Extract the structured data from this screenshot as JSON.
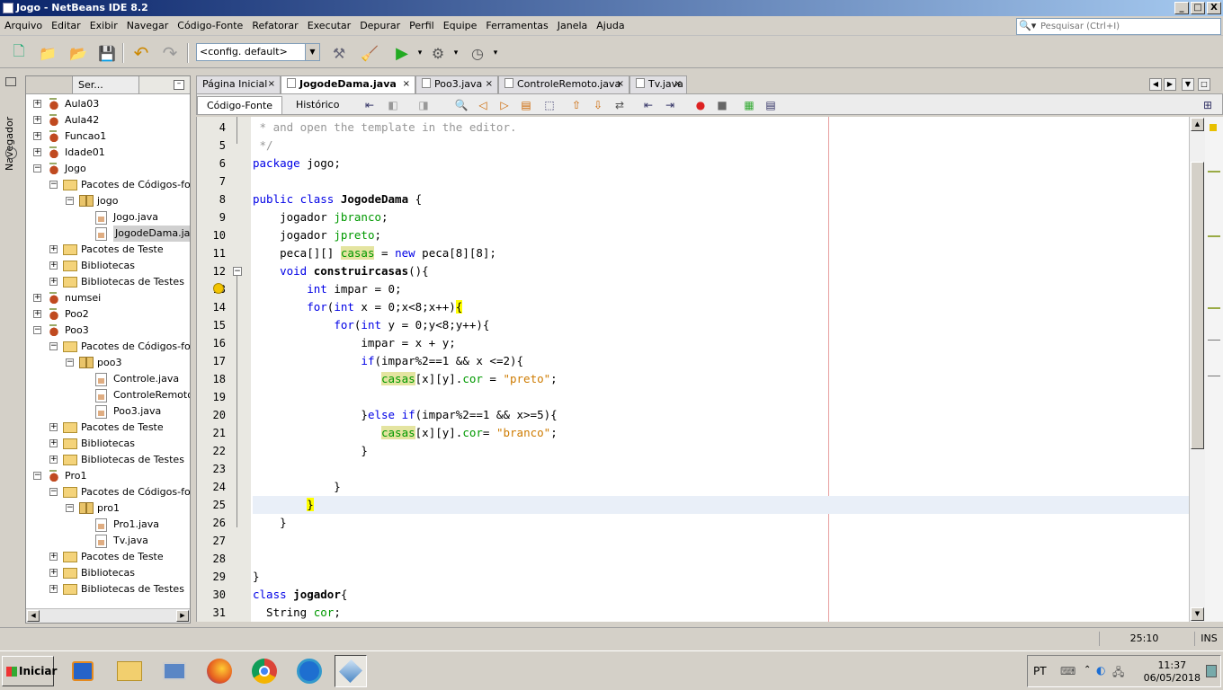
{
  "window": {
    "title": "Jogo - NetBeans IDE 8.2",
    "min": "_",
    "max": "□",
    "close": "X"
  },
  "menu": [
    "Arquivo",
    "Editar",
    "Exibir",
    "Navegar",
    "Código-Fonte",
    "Refatorar",
    "Executar",
    "Depurar",
    "Perfil",
    "Equipe",
    "Ferramentas",
    "Janela",
    "Ajuda"
  ],
  "search": {
    "placeholder": "Pesquisar (Ctrl+I)"
  },
  "toolbar": {
    "config": "<config. default>"
  },
  "navigator_label": "Navegador",
  "projects_panel": {
    "tab_label": "Ser...",
    "min": "–"
  },
  "tree": [
    {
      "label": "Aula03",
      "level": 0,
      "type": "project",
      "exp": "+"
    },
    {
      "label": "Aula42",
      "level": 0,
      "type": "project",
      "exp": "+"
    },
    {
      "label": "Funcao1",
      "level": 0,
      "type": "project",
      "exp": "+"
    },
    {
      "label": "Idade01",
      "level": 0,
      "type": "project",
      "exp": "+"
    },
    {
      "label": "Jogo",
      "level": 0,
      "type": "project",
      "exp": "−"
    },
    {
      "label": "Pacotes de Códigos-fonte",
      "level": 1,
      "type": "folder",
      "exp": "−"
    },
    {
      "label": "jogo",
      "level": 2,
      "type": "package",
      "exp": "−"
    },
    {
      "label": "Jogo.java",
      "level": 3,
      "type": "file"
    },
    {
      "label": "JogodeDama.java",
      "level": 3,
      "type": "file",
      "selected": true
    },
    {
      "label": "Pacotes de Teste",
      "level": 1,
      "type": "folder",
      "exp": "+"
    },
    {
      "label": "Bibliotecas",
      "level": 1,
      "type": "folder",
      "exp": "+"
    },
    {
      "label": "Bibliotecas de Testes",
      "level": 1,
      "type": "folder",
      "exp": "+"
    },
    {
      "label": "numsei",
      "level": 0,
      "type": "project",
      "exp": "+"
    },
    {
      "label": "Poo2",
      "level": 0,
      "type": "project",
      "exp": "+"
    },
    {
      "label": "Poo3",
      "level": 0,
      "type": "project",
      "exp": "−"
    },
    {
      "label": "Pacotes de Códigos-fonte",
      "level": 1,
      "type": "folder",
      "exp": "−"
    },
    {
      "label": "poo3",
      "level": 2,
      "type": "package",
      "exp": "−"
    },
    {
      "label": "Controle.java",
      "level": 3,
      "type": "file"
    },
    {
      "label": "ControleRemoto.java",
      "level": 3,
      "type": "file"
    },
    {
      "label": "Poo3.java",
      "level": 3,
      "type": "file"
    },
    {
      "label": "Pacotes de Teste",
      "level": 1,
      "type": "folder",
      "exp": "+"
    },
    {
      "label": "Bibliotecas",
      "level": 1,
      "type": "folder",
      "exp": "+"
    },
    {
      "label": "Bibliotecas de Testes",
      "level": 1,
      "type": "folder",
      "exp": "+"
    },
    {
      "label": "Pro1",
      "level": 0,
      "type": "project",
      "exp": "−"
    },
    {
      "label": "Pacotes de Códigos-fonte",
      "level": 1,
      "type": "folder",
      "exp": "−"
    },
    {
      "label": "pro1",
      "level": 2,
      "type": "package",
      "exp": "−"
    },
    {
      "label": "Pro1.java",
      "level": 3,
      "type": "file"
    },
    {
      "label": "Tv.java",
      "level": 3,
      "type": "file"
    },
    {
      "label": "Pacotes de Teste",
      "level": 1,
      "type": "folder",
      "exp": "+"
    },
    {
      "label": "Bibliotecas",
      "level": 1,
      "type": "folder",
      "exp": "+"
    },
    {
      "label": "Bibliotecas de Testes",
      "level": 1,
      "type": "folder",
      "exp": "+"
    }
  ],
  "editor_tabs": [
    {
      "label": "Página Inicial",
      "active": false
    },
    {
      "label": "JogodeDama.java",
      "active": true
    },
    {
      "label": "Poo3.java",
      "active": false
    },
    {
      "label": "ControleRemoto.java",
      "active": false
    },
    {
      "label": "Tv.java",
      "active": false
    }
  ],
  "editor_views": {
    "source": "Código-Fonte",
    "history": "Histórico"
  },
  "code_lines": [
    {
      "n": 4,
      "html": "<span class=\"cm\"> * and open the template in the editor.</span>"
    },
    {
      "n": 5,
      "html": "<span class=\"cm\"> */</span>"
    },
    {
      "n": 6,
      "html": "<span class=\"kw\">package</span> jogo;"
    },
    {
      "n": 7,
      "html": ""
    },
    {
      "n": 8,
      "html": "<span class=\"kw\">public class</span> <span class=\"cn\">JogodeDama</span> {"
    },
    {
      "n": 9,
      "html": "    jogador <span class=\"fld\">jbranco</span>;"
    },
    {
      "n": 10,
      "html": "    jogador <span class=\"fld\">jpreto</span>;"
    },
    {
      "n": 11,
      "html": "    peca[][] <span class=\"fldh\">casas</span> = <span class=\"kw\">new</span> peca[8][8];"
    },
    {
      "n": 12,
      "html": "    <span class=\"kw\">void</span> <span class=\"cn\">construircasas</span>(){"
    },
    {
      "n": 13,
      "html": "        <span class=\"kw\">int</span> impar = 0;"
    },
    {
      "n": 14,
      "html": "        <span class=\"kw\">for</span>(<span class=\"kw\">int</span> x = 0;x&lt;8;x++)<span class=\"brk\">{</span>"
    },
    {
      "n": 15,
      "html": "            <span class=\"kw\">for</span>(<span class=\"kw\">int</span> y = 0;y&lt;8;y++){"
    },
    {
      "n": 16,
      "html": "                impar = x + y;"
    },
    {
      "n": 17,
      "html": "                <span class=\"kw\">if</span>(impar%2==1 &amp;&amp; x &lt;=2){"
    },
    {
      "n": 18,
      "html": "                   <span class=\"fldh\">casas</span>[x][y].<span class=\"fld\">cor</span> = <span class=\"str\">\"preto\"</span>;"
    },
    {
      "n": 19,
      "html": ""
    },
    {
      "n": 20,
      "html": "                }<span class=\"kw\">else if</span>(impar%2==1 &amp;&amp; x&gt;=5){"
    },
    {
      "n": 21,
      "html": "                   <span class=\"fldh\">casas</span>[x][y].<span class=\"fld\">cor</span>= <span class=\"str\">\"branco\"</span>;"
    },
    {
      "n": 22,
      "html": "                }"
    },
    {
      "n": 23,
      "html": ""
    },
    {
      "n": 24,
      "html": "            }"
    },
    {
      "n": 25,
      "html": "        <span class=\"brk\">}</span>",
      "current": true
    },
    {
      "n": 26,
      "html": "    }"
    },
    {
      "n": 27,
      "html": ""
    },
    {
      "n": 28,
      "html": ""
    },
    {
      "n": 29,
      "html": "}"
    },
    {
      "n": 30,
      "html": "<span class=\"kw\">class</span> <span class=\"cn\">jogador</span>{"
    },
    {
      "n": 31,
      "html": "  String <span class=\"fld\">cor</span>;"
    }
  ],
  "status": {
    "position": "25:10",
    "mode": "INS"
  },
  "taskbar": {
    "start": "Iniciar",
    "lang": "PT",
    "time": "11:37",
    "date": "06/05/2018"
  }
}
